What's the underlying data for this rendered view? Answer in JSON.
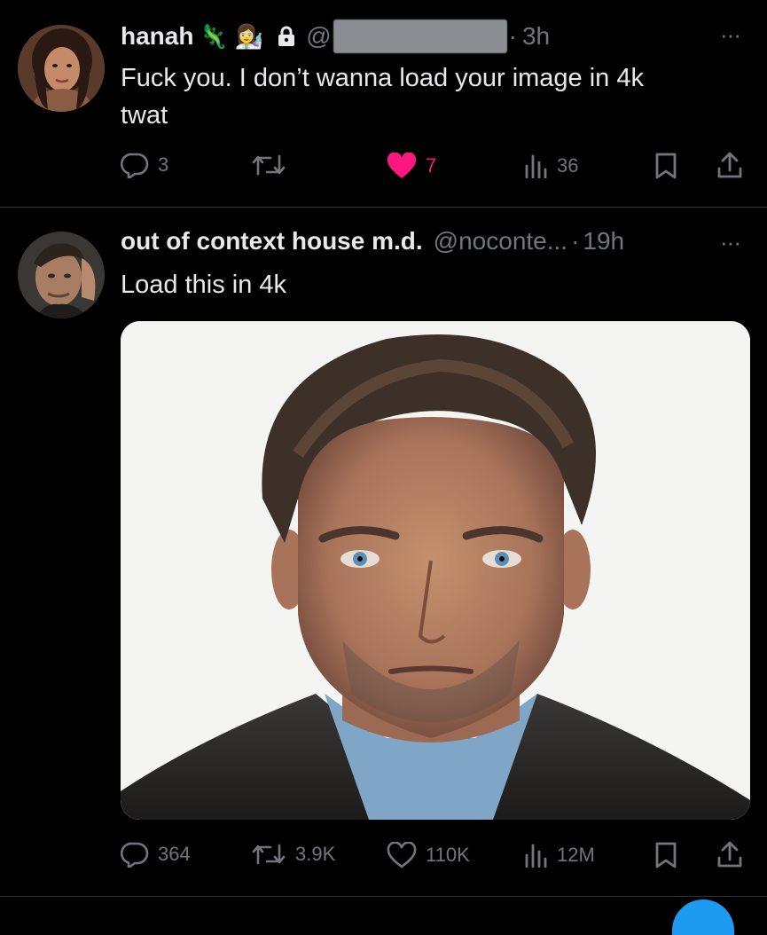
{
  "tweet1": {
    "name": "hanah",
    "emoji_1": "🦎",
    "emoji_2": "👩‍🔬",
    "at_prefix": "@",
    "separator": "·",
    "time": "3h",
    "more": "···",
    "text_line1": "Fuck you. I don’t wanna load your image in 4k",
    "text_line2": "twat",
    "actions": {
      "replies": "3",
      "retweets": "",
      "likes": "7",
      "views": "36"
    },
    "like_color": "#f91880",
    "liked": true
  },
  "tweet2": {
    "name": "out of context house m.d.",
    "handle": "@noconte...",
    "separator": "·",
    "time": "19h",
    "more": "···",
    "text": "Load this in 4k",
    "actions": {
      "replies": "364",
      "retweets": "3.9K",
      "likes": "110K",
      "views": "12M"
    }
  },
  "colors": {
    "background": "#000000",
    "text": "#e7e9ea",
    "muted": "#71767b",
    "divider": "#2f3336"
  }
}
